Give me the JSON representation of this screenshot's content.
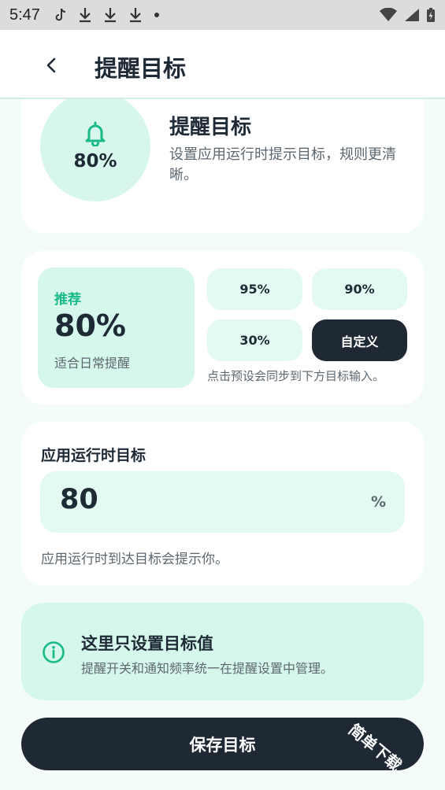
{
  "status_bar": {
    "time": "5:47",
    "icons_left": [
      "tiktok-icon",
      "download-icon",
      "download-icon",
      "download-icon",
      "dot-icon"
    ],
    "icons_right": [
      "wifi-icon",
      "signal-icon",
      "battery-charging-icon"
    ]
  },
  "appbar": {
    "back_icon": "chevron-left-icon",
    "title": "提醒目标"
  },
  "hero": {
    "icon": "bell-icon",
    "percent": "80%",
    "title": "提醒目标",
    "description": "设置应用运行时提示目标，规则更清晰。"
  },
  "presets": {
    "recommended": {
      "label": "推荐",
      "value": "80%",
      "description": "适合日常提醒"
    },
    "options": [
      "95%",
      "90%",
      "30%"
    ],
    "custom_label": "自定义",
    "hint": "点击预设会同步到下方目标输入。"
  },
  "target_input": {
    "label": "应用运行时目标",
    "value": "80",
    "unit": "%",
    "hint": "应用运行时到达目标会提示你。"
  },
  "info": {
    "icon": "info-icon",
    "title": "这里只设置目标值",
    "description": "提醒开关和通知频率统一在提醒设置中管理。"
  },
  "save_button": {
    "label": "保存目标"
  },
  "watermark": "简单下载",
  "colors": {
    "accent": "#19b98a",
    "mint": "#d6f7eb",
    "dark": "#1f2933",
    "background": "#f4fcf9"
  }
}
